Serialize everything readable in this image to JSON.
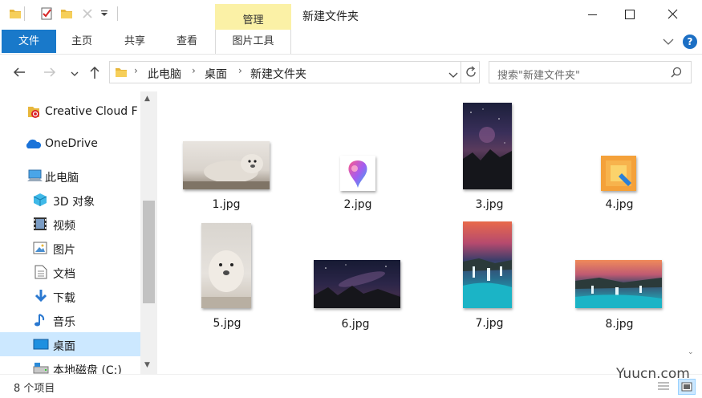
{
  "titlebar": {
    "manage_tab": "管理",
    "window_title": "新建文件夹"
  },
  "ribbon": {
    "tabs": [
      "文件",
      "主页",
      "共享",
      "查看"
    ],
    "picture_tools": "图片工具",
    "help": "?"
  },
  "address": {
    "segments": [
      "此电脑",
      "桌面",
      "新建文件夹"
    ],
    "search_placeholder": "搜索\"新建文件夹\""
  },
  "sidebar": {
    "items": [
      {
        "label": "Creative Cloud F",
        "icon": "creative-cloud-icon"
      },
      {
        "label": "OneDrive",
        "icon": "onedrive-icon"
      },
      {
        "label": "此电脑",
        "icon": "this-pc-icon"
      },
      {
        "label": "3D 对象",
        "icon": "3d-objects-icon"
      },
      {
        "label": "视频",
        "icon": "videos-icon"
      },
      {
        "label": "图片",
        "icon": "pictures-icon"
      },
      {
        "label": "文档",
        "icon": "documents-icon"
      },
      {
        "label": "下载",
        "icon": "downloads-icon"
      },
      {
        "label": "音乐",
        "icon": "music-icon"
      },
      {
        "label": "桌面",
        "icon": "desktop-icon",
        "selected": true
      },
      {
        "label": "本地磁盘 (C:)",
        "icon": "local-disk-icon"
      }
    ]
  },
  "files": [
    {
      "name": "1.jpg"
    },
    {
      "name": "2.jpg"
    },
    {
      "name": "3.jpg"
    },
    {
      "name": "4.jpg"
    },
    {
      "name": "5.jpg"
    },
    {
      "name": "6.jpg"
    },
    {
      "name": "7.jpg"
    },
    {
      "name": "8.jpg"
    }
  ],
  "status": {
    "item_count": "8 个项目"
  },
  "watermark": "Yuucn.com",
  "colors": {
    "accent": "#1979ca",
    "manage_tab": "#fbf1a6",
    "selected": "#cce8ff"
  }
}
